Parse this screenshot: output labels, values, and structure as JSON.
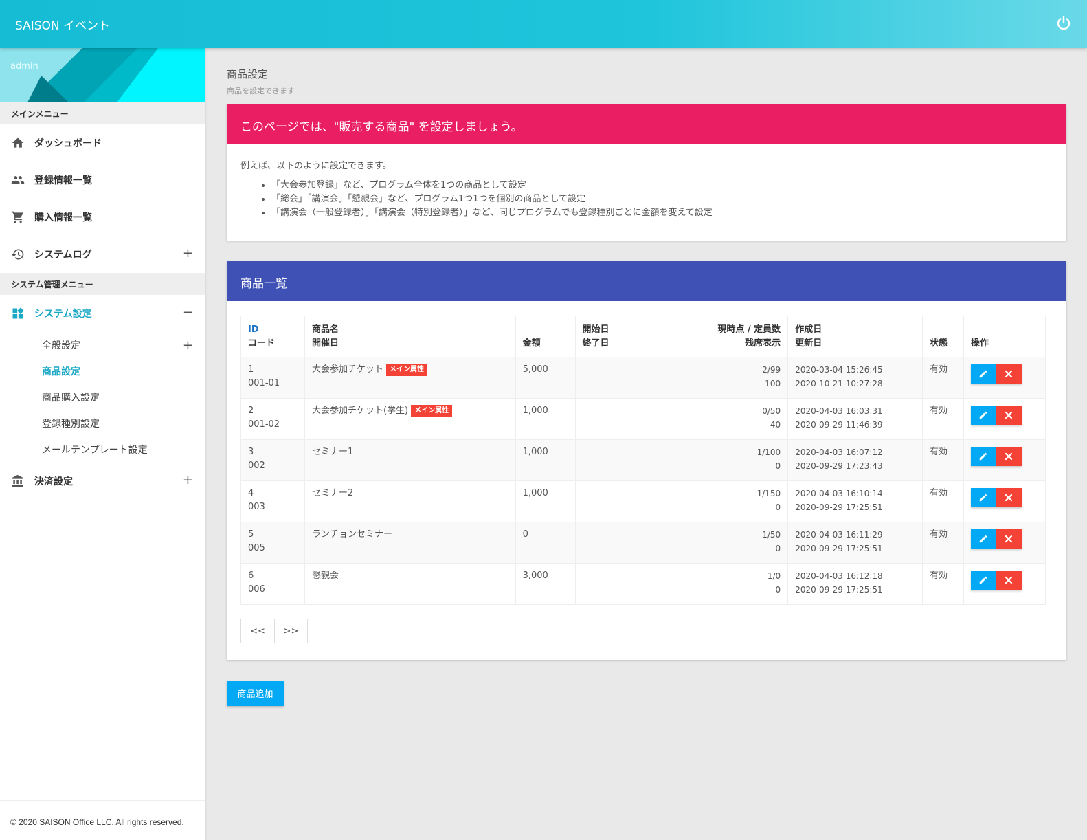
{
  "header": {
    "app_title": "SAISON イベント",
    "power_icon": "power-icon"
  },
  "sidebar": {
    "user_name": "admin",
    "main_menu_header": "メインメニュー",
    "main_items": [
      {
        "label": "ダッシュボード",
        "icon": "home-icon"
      },
      {
        "label": "登録情報一覧",
        "icon": "people-icon"
      },
      {
        "label": "購入情報一覧",
        "icon": "cart-icon"
      },
      {
        "label": "システムログ",
        "icon": "history-icon",
        "toggle": "+"
      }
    ],
    "admin_menu_header": "システム管理メニュー",
    "system_settings": {
      "label": "システム設定",
      "icon": "dashboard-icon",
      "toggle": "−"
    },
    "sub_items": [
      {
        "label": "全般設定",
        "toggle": "+"
      },
      {
        "label": "商品設定"
      },
      {
        "label": "商品購入設定"
      },
      {
        "label": "登録種別設定"
      },
      {
        "label": "メールテンプレート設定"
      }
    ],
    "payment": {
      "label": "決済設定",
      "icon": "bank-icon",
      "toggle": "+"
    },
    "footer": "© 2020 SAISON Office LLC. All rights reserved."
  },
  "page": {
    "title": "商品設定",
    "subtitle": "商品を設定できます"
  },
  "info_card": {
    "heading": "このページでは、\"販売する商品\" を設定しましょう。",
    "intro": "例えば、以下のように設定できます。",
    "bullets": [
      "「大会参加登録」など、プログラム全体を1つの商品として設定",
      "「総会」「講演会」「懇親会」など、プログラム1つ1つを個別の商品として設定",
      "「講演会（一般登録者）」「講演会（特別登録者）」など、同じプログラムでも登録種別ごとに金額を変えて設定"
    ]
  },
  "list_card": {
    "heading": "商品一覧",
    "columns": {
      "id": "ID",
      "code": "コード",
      "name": "商品名",
      "held": "開催日",
      "price": "金額",
      "start": "開始日",
      "end": "終了日",
      "capacity": "現時点 / 定員数",
      "remaining": "残席表示",
      "created": "作成日",
      "updated": "更新日",
      "status": "状態",
      "ops": "操作"
    },
    "rows": [
      {
        "id": "1",
        "code": "001-01",
        "name": "大会参加チケット",
        "badge": "メイン属性",
        "price": "5,000",
        "capacity": "2/99",
        "remaining": "100",
        "created": "2020-03-04 15:26:45",
        "updated": "2020-10-21 10:27:28",
        "status": "有効"
      },
      {
        "id": "2",
        "code": "001-02",
        "name": "大会参加チケット(学生)",
        "badge": "メイン属性",
        "price": "1,000",
        "capacity": "0/50",
        "remaining": "40",
        "created": "2020-04-03 16:03:31",
        "updated": "2020-09-29 11:46:39",
        "status": "有効"
      },
      {
        "id": "3",
        "code": "002",
        "name": "セミナー1",
        "badge": "",
        "price": "1,000",
        "capacity": "1/100",
        "remaining": "0",
        "created": "2020-04-03 16:07:12",
        "updated": "2020-09-29 17:23:43",
        "status": "有効"
      },
      {
        "id": "4",
        "code": "003",
        "name": "セミナー2",
        "badge": "",
        "price": "1,000",
        "capacity": "1/150",
        "remaining": "0",
        "created": "2020-04-03 16:10:14",
        "updated": "2020-09-29 17:25:51",
        "status": "有効"
      },
      {
        "id": "5",
        "code": "005",
        "name": "ランチョンセミナー",
        "badge": "",
        "price": "0",
        "capacity": "1/50",
        "remaining": "0",
        "created": "2020-04-03 16:11:29",
        "updated": "2020-09-29 17:25:51",
        "status": "有効"
      },
      {
        "id": "6",
        "code": "006",
        "name": "懇親会",
        "badge": "",
        "price": "3,000",
        "capacity": "1/0",
        "remaining": "0",
        "created": "2020-04-03 16:12:18",
        "updated": "2020-09-29 17:25:51",
        "status": "有効"
      }
    ],
    "pager": {
      "prev": "<<",
      "next": ">>"
    }
  },
  "add_button": "商品追加",
  "colors": {
    "header": "#16bcd4",
    "info_head": "#e91e63",
    "list_head": "#3f51b5",
    "edit": "#03a9f4",
    "delete": "#f44336",
    "accent": "#1aa8c4"
  }
}
